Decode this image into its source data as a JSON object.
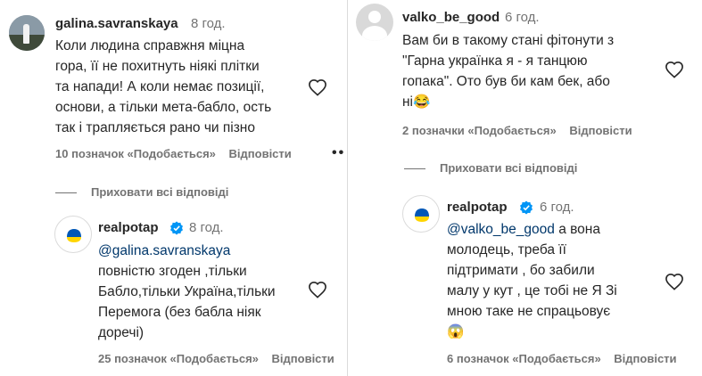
{
  "left": {
    "comment": {
      "username": "galina.savranskaya",
      "time": "8 год.",
      "lines": [
        "Коли людина справжня міцна",
        "гора, її не похитнуть ніякі плітки",
        "та напади! А коли немає позиції,",
        "основи, а тільки мета-бабло, ость",
        "так і трапляється рано чи пізно"
      ],
      "likes": "10 позначок «Подобається»",
      "reply": "Відповісти",
      "more": "••"
    },
    "hide_replies": "Приховати всі відповіді",
    "reply": {
      "username": "realpotap",
      "time": "8 год.",
      "mention": "@galina.savranskaya",
      "lines": [
        "повністю згоден ,тільки",
        "Бабло,тільки Україна,тільки",
        "Перемога (без бабла ніяк",
        "доречі)"
      ],
      "likes": "25 позначок «Подобається»",
      "reply": "Відповісти"
    }
  },
  "right": {
    "comment": {
      "username": "valko_be_good",
      "time": "6 год.",
      "lines": [
        "Вам би в такому стані фітонути з",
        "\"Гарна українка я - я танцюю",
        "гопака\". Ото був би кам бек, або",
        "ні😂"
      ],
      "likes": "2 позначки «Подобається»",
      "reply": "Відповісти"
    },
    "hide_replies": "Приховати всі відповіді",
    "reply": {
      "username": "realpotap",
      "time": "6 год.",
      "mention": "@valko_be_good",
      "first_line_rest": " а вона",
      "lines": [
        "молодець, треба її",
        "підтримати , бо забили",
        "малу у кут , це тобі не Я Зі",
        "мною таке не спрацьовує",
        "😱"
      ],
      "likes": "6 позначок «Подобається»",
      "reply": "Відповісти"
    }
  },
  "colors": {
    "primary_text": "#262626",
    "secondary_text": "#737373",
    "mention": "#00376b",
    "verified": "#0095f6"
  }
}
